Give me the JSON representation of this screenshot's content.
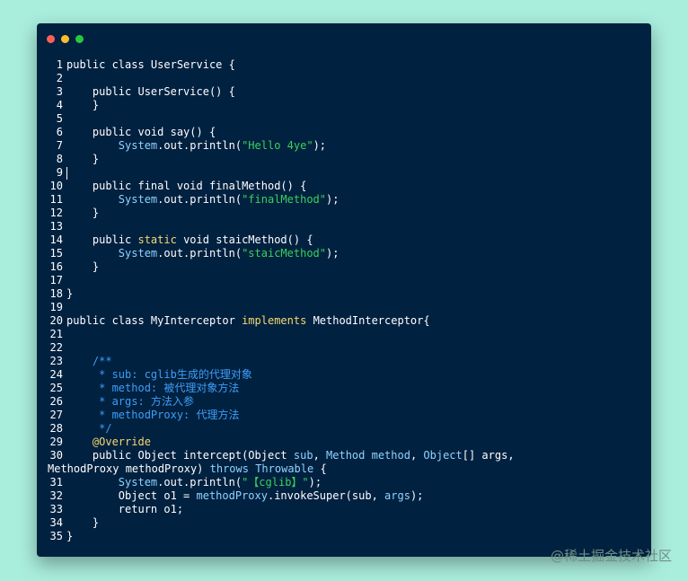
{
  "window": {
    "traffic_lights": [
      {
        "name": "close",
        "color": "#ff5f57"
      },
      {
        "name": "minimize",
        "color": "#febc2e"
      },
      {
        "name": "maximize",
        "color": "#28c840"
      }
    ]
  },
  "code_lines": [
    {
      "n": "1",
      "tokens": [
        [
          "kw2",
          "public class "
        ],
        [
          "",
          "UserService {"
        ]
      ]
    },
    {
      "n": "2",
      "tokens": []
    },
    {
      "n": "3",
      "tokens": [
        [
          "",
          "    "
        ],
        [
          "kw2",
          "public "
        ],
        [
          "",
          "UserService() {"
        ]
      ]
    },
    {
      "n": "4",
      "tokens": [
        [
          "",
          "    }"
        ]
      ]
    },
    {
      "n": "5",
      "tokens": []
    },
    {
      "n": "6",
      "tokens": [
        [
          "",
          "    "
        ],
        [
          "kw2",
          "public void "
        ],
        [
          "",
          "say() {"
        ]
      ]
    },
    {
      "n": "7",
      "tokens": [
        [
          "",
          "        "
        ],
        [
          "ty",
          "System"
        ],
        [
          "",
          ".out.println("
        ],
        [
          "str",
          "\"Hello 4ye\""
        ],
        [
          "",
          ");"
        ]
      ]
    },
    {
      "n": "8",
      "tokens": [
        [
          "",
          "    }"
        ]
      ]
    },
    {
      "n": "9",
      "tokens": [
        [
          "caret",
          ""
        ]
      ]
    },
    {
      "n": "10",
      "tokens": [
        [
          "",
          "    "
        ],
        [
          "kw2",
          "public final void "
        ],
        [
          "",
          "finalMethod() {"
        ]
      ]
    },
    {
      "n": "11",
      "tokens": [
        [
          "",
          "        "
        ],
        [
          "ty",
          "System"
        ],
        [
          "",
          ".out.println("
        ],
        [
          "str",
          "\"finalMethod\""
        ],
        [
          "",
          ");"
        ]
      ]
    },
    {
      "n": "12",
      "tokens": [
        [
          "",
          "    }"
        ]
      ]
    },
    {
      "n": "13",
      "tokens": []
    },
    {
      "n": "14",
      "tokens": [
        [
          "",
          "    "
        ],
        [
          "kw2",
          "public "
        ],
        [
          "kw",
          "static "
        ],
        [
          "kw2",
          "void "
        ],
        [
          "",
          "staicMethod() {"
        ]
      ]
    },
    {
      "n": "15",
      "tokens": [
        [
          "",
          "        "
        ],
        [
          "ty",
          "System"
        ],
        [
          "",
          ".out.println("
        ],
        [
          "str",
          "\"staicMethod\""
        ],
        [
          "",
          ");"
        ]
      ]
    },
    {
      "n": "16",
      "tokens": [
        [
          "",
          "    }"
        ]
      ]
    },
    {
      "n": "17",
      "tokens": []
    },
    {
      "n": "18",
      "tokens": [
        [
          "",
          "}"
        ]
      ]
    },
    {
      "n": "19",
      "tokens": []
    },
    {
      "n": "20",
      "tokens": [
        [
          "kw2",
          "public class "
        ],
        [
          "",
          "MyInterceptor "
        ],
        [
          "kw",
          "implements "
        ],
        [
          "",
          "MethodInterceptor{"
        ]
      ]
    },
    {
      "n": "21",
      "tokens": []
    },
    {
      "n": "22",
      "tokens": []
    },
    {
      "n": "23",
      "tokens": [
        [
          "",
          "    "
        ],
        [
          "cm",
          "/**"
        ]
      ]
    },
    {
      "n": "24",
      "tokens": [
        [
          "cm",
          "     * sub: cglib生成的代理对象"
        ]
      ]
    },
    {
      "n": "25",
      "tokens": [
        [
          "cm",
          "     * method: 被代理对象方法"
        ]
      ]
    },
    {
      "n": "26",
      "tokens": [
        [
          "cm",
          "     * args: 方法入参"
        ]
      ]
    },
    {
      "n": "27",
      "tokens": [
        [
          "cm",
          "     * methodProxy: 代理方法"
        ]
      ]
    },
    {
      "n": "28",
      "tokens": [
        [
          "cm",
          "     */"
        ]
      ]
    },
    {
      "n": "29",
      "tokens": [
        [
          "",
          "    "
        ],
        [
          "an",
          "@Override"
        ]
      ]
    },
    {
      "n": "30",
      "wrapped": true,
      "tokens": [
        [
          "",
          "    "
        ],
        [
          "kw2",
          "public "
        ],
        [
          "",
          "Object intercept(Object "
        ],
        [
          "ty",
          "sub"
        ],
        [
          ", ",
          ", "
        ],
        [
          "ty",
          "Method method"
        ],
        [
          "",
          ", "
        ],
        [
          "ty",
          "Object"
        ],
        [
          "",
          "[] args, MethodProxy methodProxy) "
        ],
        [
          "ty",
          "throws Throwable"
        ],
        [
          "",
          " {"
        ]
      ]
    },
    {
      "n": "31",
      "tokens": [
        [
          "",
          "        "
        ],
        [
          "ty",
          "System"
        ],
        [
          "",
          ".out.println("
        ],
        [
          "str",
          "\"【cglib】\""
        ],
        [
          "",
          ");"
        ]
      ]
    },
    {
      "n": "32",
      "tokens": [
        [
          "",
          "        Object o1 = "
        ],
        [
          "ty",
          "methodProxy"
        ],
        [
          "",
          ".invokeSuper(sub, "
        ],
        [
          "ty",
          "args"
        ],
        [
          "",
          ");"
        ]
      ]
    },
    {
      "n": "33",
      "tokens": [
        [
          "",
          "        "
        ],
        [
          "kw2",
          "return "
        ],
        [
          "",
          "o1;"
        ]
      ]
    },
    {
      "n": "34",
      "tokens": [
        [
          "",
          "    }"
        ]
      ]
    },
    {
      "n": "35",
      "tokens": [
        [
          "",
          "}"
        ]
      ]
    }
  ],
  "watermark": "@稀土掘金技术社区"
}
